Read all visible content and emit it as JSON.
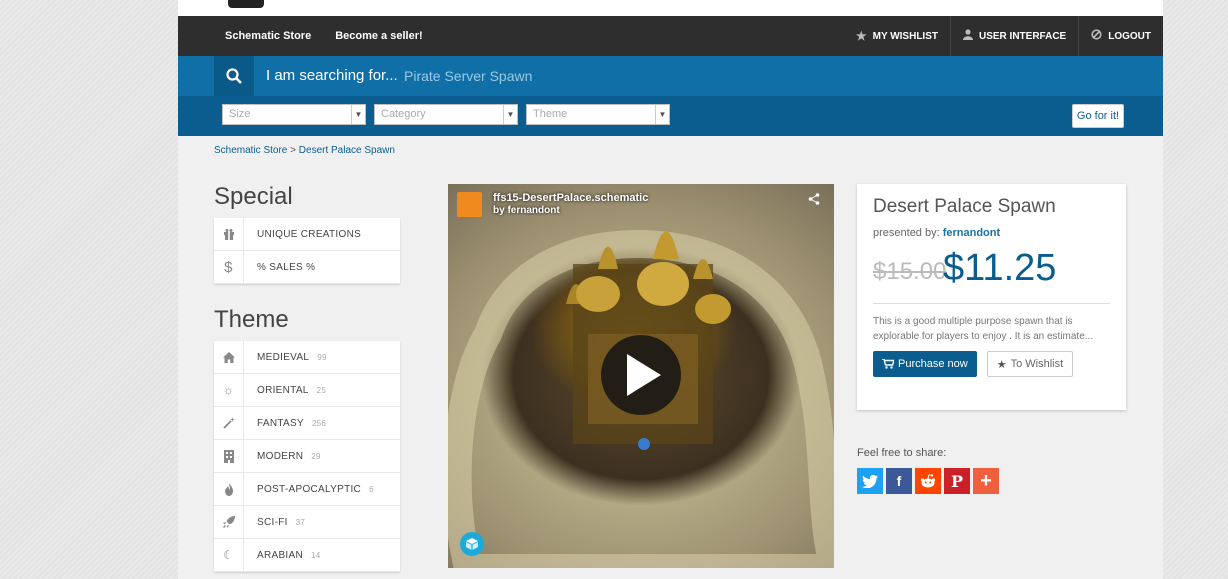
{
  "nav": {
    "left": [
      "Schematic Store",
      "Become a seller!"
    ],
    "right": [
      {
        "icon": "star-icon",
        "label": "MY WISHLIST"
      },
      {
        "icon": "user-icon",
        "label": "USER INTERFACE"
      },
      {
        "icon": "power-icon",
        "label": "LOGOUT"
      }
    ]
  },
  "search": {
    "label": "I am searching for...",
    "value": "Pirate Server Spawn"
  },
  "filters": {
    "size": "Size",
    "category": "Category",
    "theme": "Theme",
    "go": "Go for it!"
  },
  "breadcrumb": {
    "root": "Schematic Store",
    "sep": ">",
    "current": "Desert Palace Spawn"
  },
  "special": {
    "heading": "Special",
    "items": [
      {
        "icon": "gift-icon",
        "label": "UNIQUE CREATIONS"
      },
      {
        "icon": "dollar-icon",
        "label": "% SALES %"
      }
    ]
  },
  "theme": {
    "heading": "Theme",
    "items": [
      {
        "icon": "home-icon",
        "label": "MEDIEVAL",
        "count": "99"
      },
      {
        "icon": "sun-icon",
        "label": "ORIENTAL",
        "count": "25"
      },
      {
        "icon": "wand-icon",
        "label": "FANTASY",
        "count": "256"
      },
      {
        "icon": "building-icon",
        "label": "MODERN",
        "count": "29"
      },
      {
        "icon": "fire-icon",
        "label": "POST-APOCALYPTIC",
        "count": "6"
      },
      {
        "icon": "rocket-icon",
        "label": "SCI-FI",
        "count": "37"
      },
      {
        "icon": "moon-icon",
        "label": "ARABIAN",
        "count": "14"
      }
    ]
  },
  "video": {
    "title": "ffs15-DesertPalace.schematic",
    "by": "by fernandont"
  },
  "product": {
    "title": "Desert Palace Spawn",
    "presented_label": "presented by:",
    "author": "fernandont",
    "old_price": "$15.00",
    "price": "$11.25",
    "description": "This is a good multiple purpose spawn that is explorable for players to enjoy . It is an estimate...",
    "purchase": "Purchase now",
    "wishlist": "To Wishlist"
  },
  "share": {
    "label": "Feel free to share:",
    "buttons": [
      {
        "name": "twitter",
        "color": "#1da1f2"
      },
      {
        "name": "facebook",
        "color": "#3b5998"
      },
      {
        "name": "reddit",
        "color": "#ff4500"
      },
      {
        "name": "pinterest",
        "color": "#cb2027"
      },
      {
        "name": "more",
        "color": "#f0603e"
      }
    ]
  }
}
